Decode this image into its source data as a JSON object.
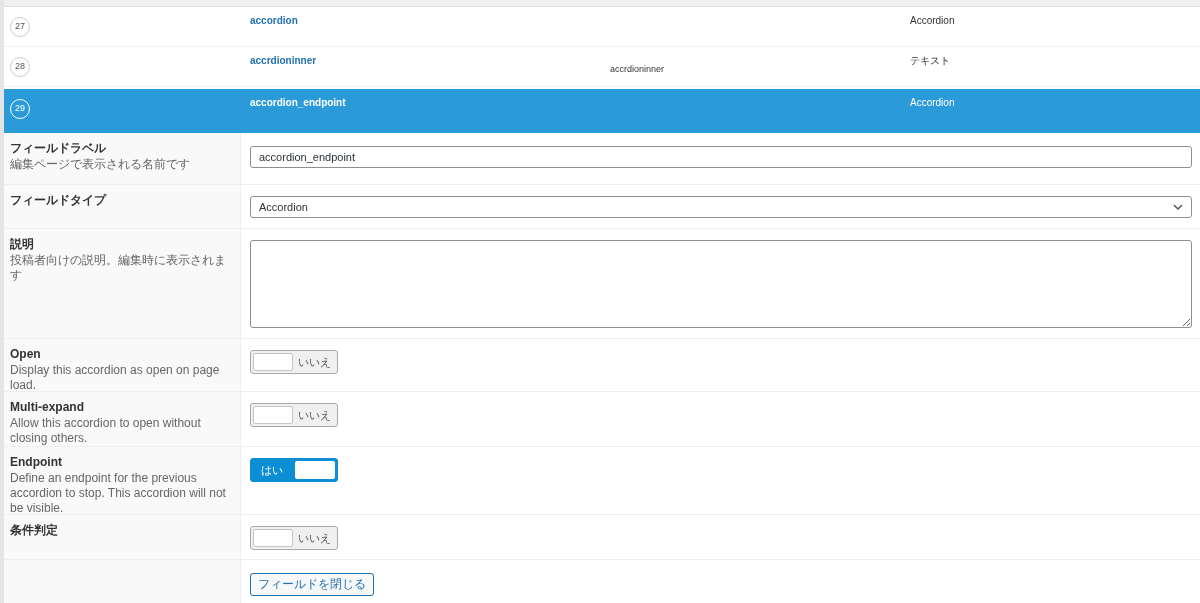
{
  "field_rows": [
    {
      "number": "27",
      "label": "accordion",
      "name": "",
      "type": "Accordion",
      "selected": false
    },
    {
      "number": "28",
      "label": "accrdioninner",
      "name": "accrdioninner",
      "type": "テキスト",
      "selected": false
    },
    {
      "number": "29",
      "label": "accordion_endpoint",
      "name": "",
      "type": "Accordion",
      "selected": true
    }
  ],
  "settings": [
    {
      "kind": "text",
      "label": "フィールドラベル",
      "description": "編集ページで表示される名前です",
      "value": "accordion_endpoint"
    },
    {
      "kind": "select",
      "label": "フィールドタイプ",
      "value": "Accordion"
    },
    {
      "kind": "textarea",
      "label": "説明",
      "description": "投稿者向けの説明。編集時に表示されます"
    },
    {
      "kind": "toggle",
      "label": "Open",
      "description": "Display this accordion as open on page load.",
      "on": false,
      "state_text": "いいえ"
    },
    {
      "kind": "toggle",
      "label": "Multi-expand",
      "description": "Allow this accordion to open without closing others.",
      "on": false,
      "state_text": "いいえ"
    },
    {
      "kind": "toggle",
      "label": "Endpoint",
      "description": "Define an endpoint for the previous accordion to stop. This accordion will not be visible.",
      "on": true,
      "state_text": "はい"
    },
    {
      "kind": "toggle",
      "label": "条件判定",
      "on": false,
      "state_text": "いいえ"
    }
  ],
  "close_button": "フィールドを閉じる"
}
